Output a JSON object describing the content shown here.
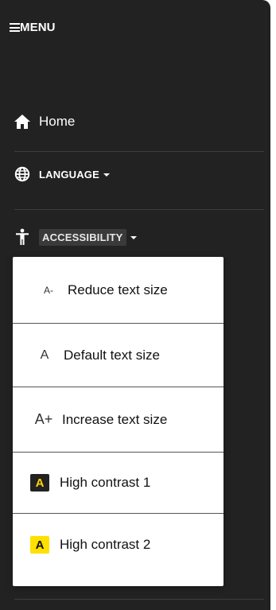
{
  "menu": {
    "toggle_label": "MENU"
  },
  "nav": {
    "home_label": "Home",
    "language_label": "LANGUAGE",
    "accessibility_label": "ACCESSIBILITY"
  },
  "accessibility_menu": {
    "items": [
      {
        "icon_text": "A-",
        "label": "Reduce text size"
      },
      {
        "icon_text": "A",
        "label": "Default text size"
      },
      {
        "icon_text": "A+",
        "label": "Increase text size"
      },
      {
        "icon_text": "A",
        "label": "High contrast 1"
      },
      {
        "icon_text": "A",
        "label": "High contrast 2"
      }
    ]
  },
  "colors": {
    "sidebar_bg": "#222222",
    "high_contrast_1_bg": "#222222",
    "high_contrast_1_fg": "#ffd700",
    "high_contrast_2_bg": "#ffe000",
    "high_contrast_2_fg": "#111111"
  },
  "icons": {
    "menu": "hamburger-icon",
    "home": "home-icon",
    "language": "globe-icon",
    "accessibility": "accessibility-person-icon",
    "dropdown": "caret-down-icon"
  }
}
